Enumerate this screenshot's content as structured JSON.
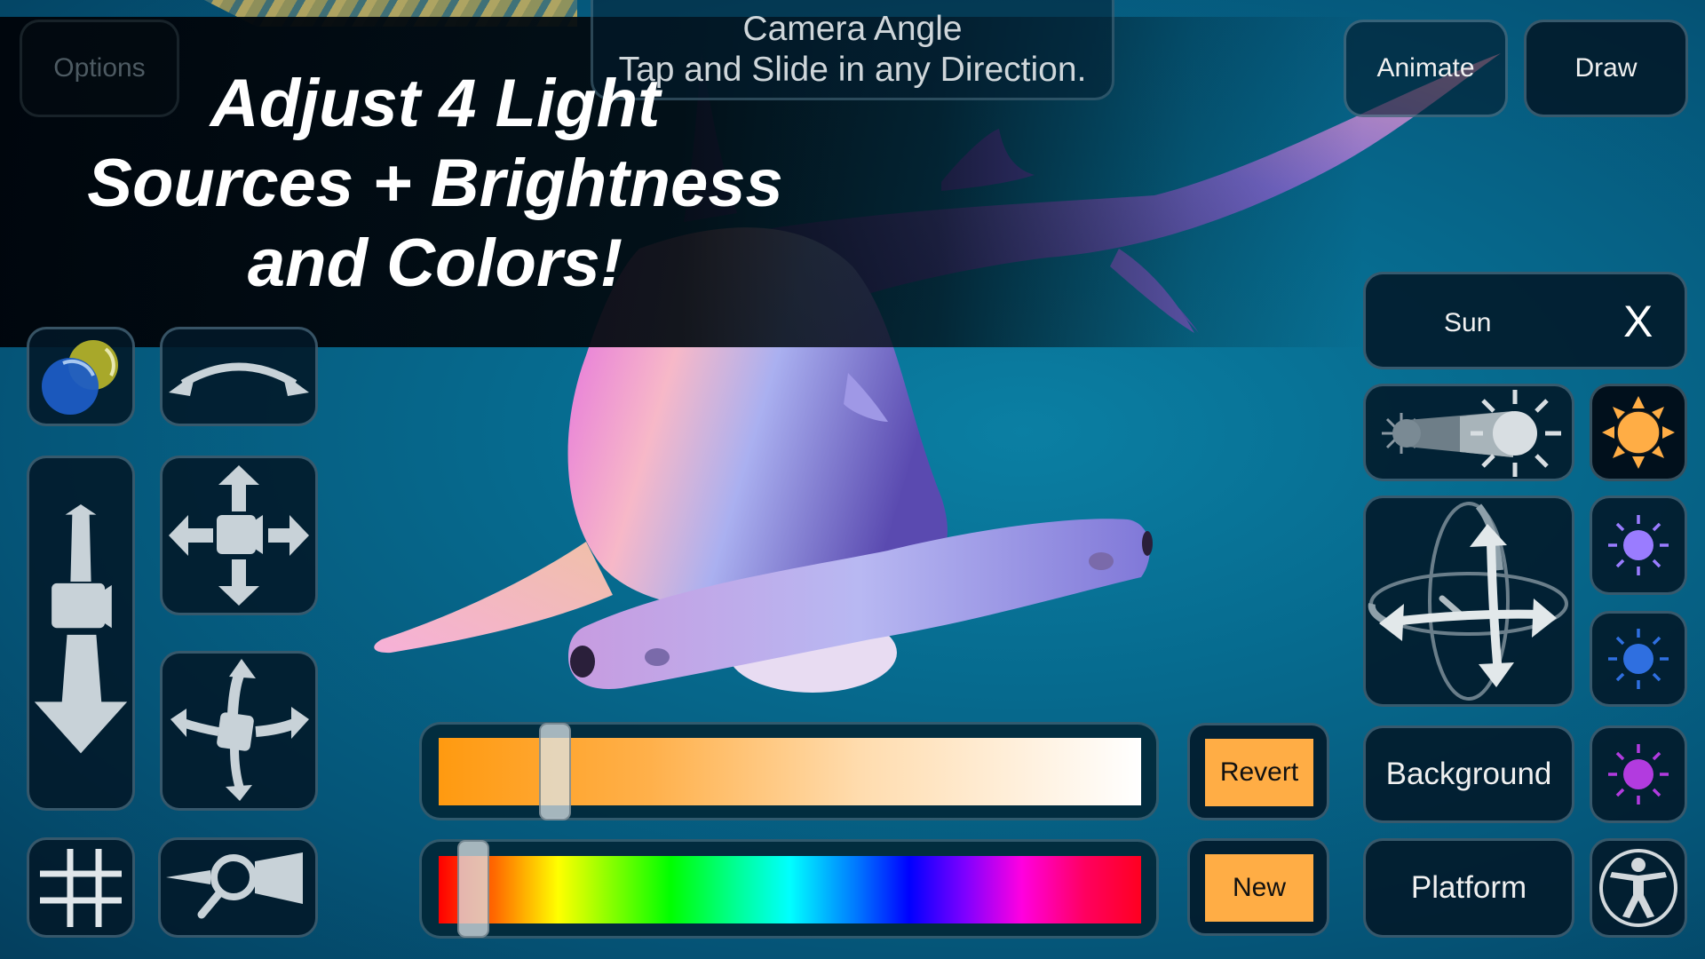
{
  "promo": {
    "headline_lines": [
      "Adjust 4 Light",
      "Sources + Brightness",
      "and Colors!"
    ]
  },
  "top_bar": {
    "options_label": "Options",
    "info_title": "Camera Angle",
    "info_subtitle": "Tap and Slide in any Direction.",
    "animate_label": "Animate",
    "draw_label": "Draw"
  },
  "left_tools": [
    {
      "name": "light-sources",
      "icon": "light-balls-icon"
    },
    {
      "name": "arc-rotate",
      "icon": "curved-arrow-icon"
    },
    {
      "name": "dolly",
      "icon": "camera-dolly-icon"
    },
    {
      "name": "pan",
      "icon": "camera-pan-icon"
    },
    {
      "name": "orbit",
      "icon": "camera-orbit-icon"
    },
    {
      "name": "grid",
      "icon": "grid-icon"
    },
    {
      "name": "zoom",
      "icon": "magnify-zoom-icon"
    }
  ],
  "light_panel": {
    "title": "Sun",
    "close_label": "X",
    "brightness_icon": "brightness-slider-icon",
    "rotate_icon": "rotate-light-icon",
    "lights": [
      {
        "name": "sun",
        "color": "#ffad45",
        "selected": true
      },
      {
        "name": "light-2",
        "color": "#9a7cff",
        "selected": false
      },
      {
        "name": "light-3",
        "color": "#2f6fe0",
        "selected": false
      },
      {
        "name": "light-4",
        "color": "#b23bdf",
        "selected": false
      }
    ]
  },
  "sliders": {
    "brightness": {
      "value": 0.165,
      "start_color": "#ff9a10",
      "end_color": "#ffffff"
    },
    "hue": {
      "value": 0.049
    }
  },
  "buttons": {
    "revert_label": "Revert",
    "new_label": "New",
    "background_label": "Background",
    "platform_label": "Platform",
    "figure_icon": "human-figure-icon"
  },
  "colors": {
    "accent_orange": "#ffad45",
    "panel_bg": "#021828"
  }
}
